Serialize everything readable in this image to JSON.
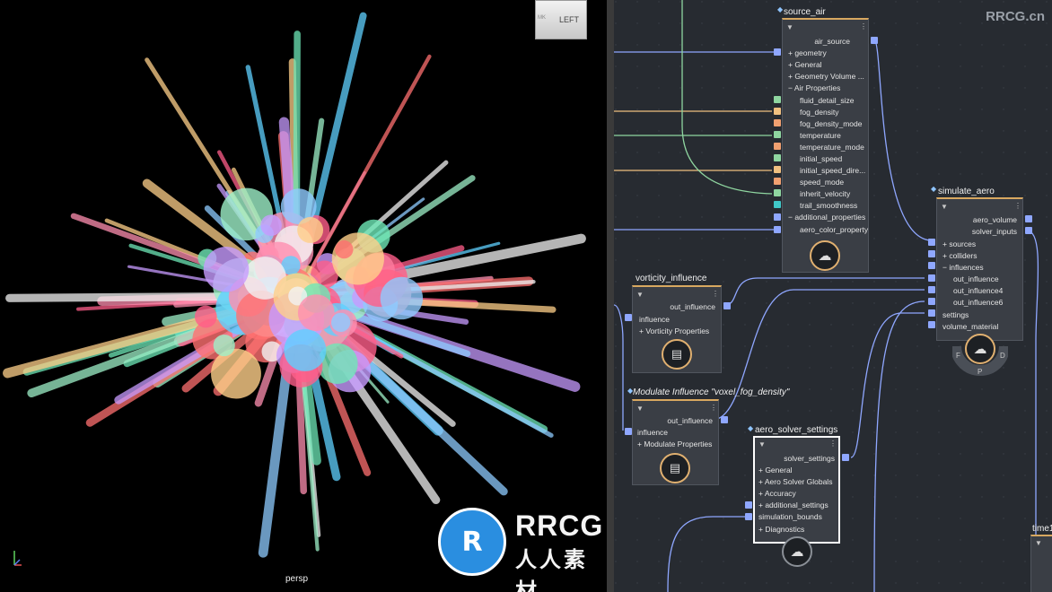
{
  "viewport": {
    "camera_label": "persp",
    "viewcube_label": "LEFT",
    "viewcube_small": "MK"
  },
  "watermarks": {
    "corner": "RRCG.cn",
    "logo_big": "RRCG",
    "logo_sub": "人人素材"
  },
  "nodes": {
    "source_air": {
      "title": "source_air",
      "output": "air_source",
      "rows": [
        "+ geometry",
        "+ General",
        "+ Geometry Volume ...",
        "− Air Properties",
        "fluid_detail_size",
        "fog_density",
        "fog_density_mode",
        "temperature",
        "temperature_mode",
        "initial_speed",
        "initial_speed_dire...",
        "speed_mode",
        "inherit_velocity",
        "trail_smoothness",
        "− additional_properties",
        "aero_color_property"
      ]
    },
    "simulate_aero": {
      "title": "simulate_aero",
      "outputs": [
        "aero_volume",
        "solver_inputs"
      ],
      "rows": [
        "+ sources",
        "+ colliders",
        "− influences",
        "out_influence",
        "out_influence4",
        "out_influence6",
        "settings",
        "volume_material"
      ],
      "ring_labels": [
        "F",
        "D",
        "P"
      ]
    },
    "vorticity_influence": {
      "title": "vorticity_influence",
      "output": "out_influence",
      "rows": [
        "influence",
        "+ Vorticity Properties"
      ]
    },
    "modulate_influence": {
      "title": "Modulate Influence \"voxel_fog_density\"",
      "output": "out_influence",
      "rows": [
        "influence",
        "+ Modulate Properties"
      ]
    },
    "aero_solver_settings": {
      "title": "aero_solver_settings",
      "output": "solver_settings",
      "rows": [
        "+ General",
        "+ Aero Solver Globals",
        "+ Accuracy",
        "+ additional_settings",
        "simulation_bounds",
        "+ Diagnostics"
      ]
    },
    "time": {
      "title": "time1"
    }
  }
}
